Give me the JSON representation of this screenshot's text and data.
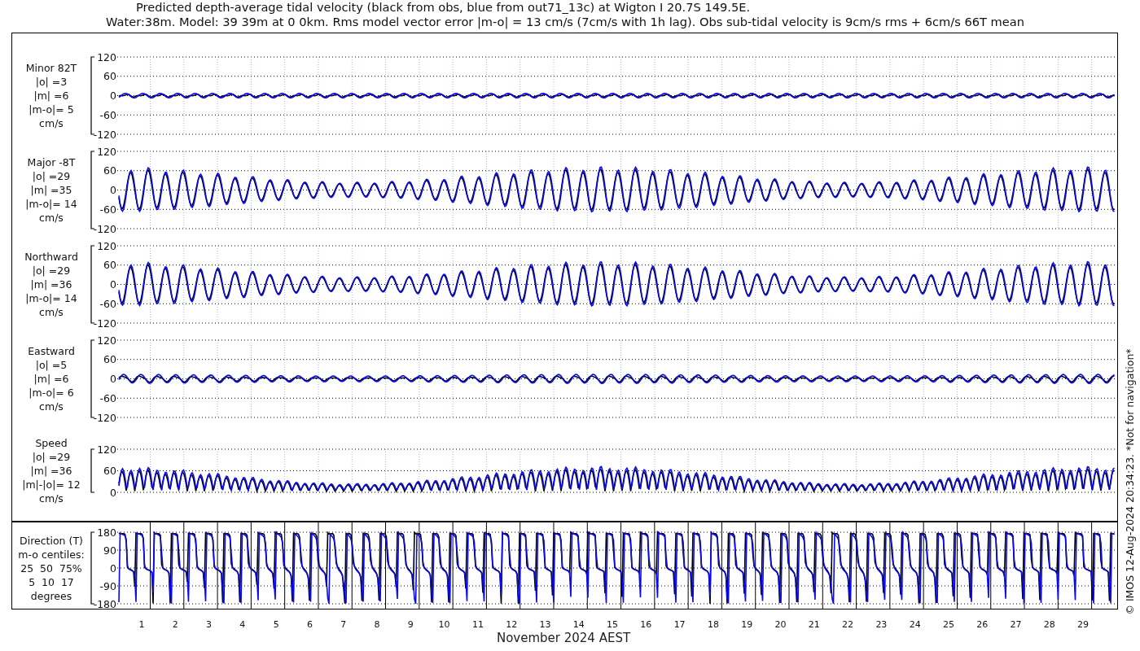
{
  "title_lines": [
    "Predicted depth-average tidal velocity (black from obs, blue from out71_13c) at Wigton I 20.7S 149.5E.",
    "Water:38m. Model: 39 39m at 0 0km. Rms model vector error |m-o| = 13 cm/s (7cm/s with 1h lag). Obs sub-tidal velocity is 9cm/s rms + 6cm/s 66T mean"
  ],
  "panels": [
    {
      "kind": "signed",
      "label_lines": [
        "Minor 82T",
        "|o| =3",
        "|m| =6",
        "|m-o|= 5",
        "cm/s"
      ],
      "yticks": [
        "120",
        "60",
        "0",
        "-60",
        "-120"
      ]
    },
    {
      "kind": "signed",
      "label_lines": [
        "Major -8T",
        "|o| =29",
        "|m| =35",
        "|m-o|= 14",
        "cm/s"
      ],
      "yticks": [
        "120",
        "60",
        "0",
        "-60",
        "-120"
      ]
    },
    {
      "kind": "signed",
      "label_lines": [
        "Northward",
        "|o| =29",
        "|m| =36",
        "|m-o|= 14",
        "cm/s"
      ],
      "yticks": [
        "120",
        "60",
        "0",
        "-60",
        "-120"
      ]
    },
    {
      "kind": "signed",
      "label_lines": [
        "Eastward",
        "|o| =5",
        "|m| =6",
        "|m-o|= 6",
        "cm/s"
      ],
      "yticks": [
        "120",
        "60",
        "0",
        "-60",
        "-120"
      ]
    },
    {
      "kind": "speed",
      "label_lines": [
        "Speed",
        "|o| =29",
        "|m| =36",
        "|m|-|o|= 12",
        "cm/s"
      ],
      "yticks": [
        "120",
        "60",
        "0"
      ]
    },
    {
      "kind": "direction",
      "label_lines": [
        "Direction (T)",
        "m-o centiles:",
        "25  50  75%",
        "5  10  17",
        "degrees"
      ],
      "yticks": [
        "180",
        "90",
        "0",
        "-90",
        "-180"
      ]
    }
  ],
  "x_axis": {
    "ticks": [
      "1",
      "2",
      "3",
      "4",
      "5",
      "6",
      "7",
      "8",
      "9",
      "10",
      "11",
      "12",
      "13",
      "14",
      "15",
      "16",
      "17",
      "18",
      "19",
      "20",
      "21",
      "22",
      "23",
      "24",
      "25",
      "26",
      "27",
      "28",
      "29"
    ],
    "label": "November 2024 AEST"
  },
  "credit": "© IMOS 12-Aug-2024 20:34:23. *Not for navigation*"
}
